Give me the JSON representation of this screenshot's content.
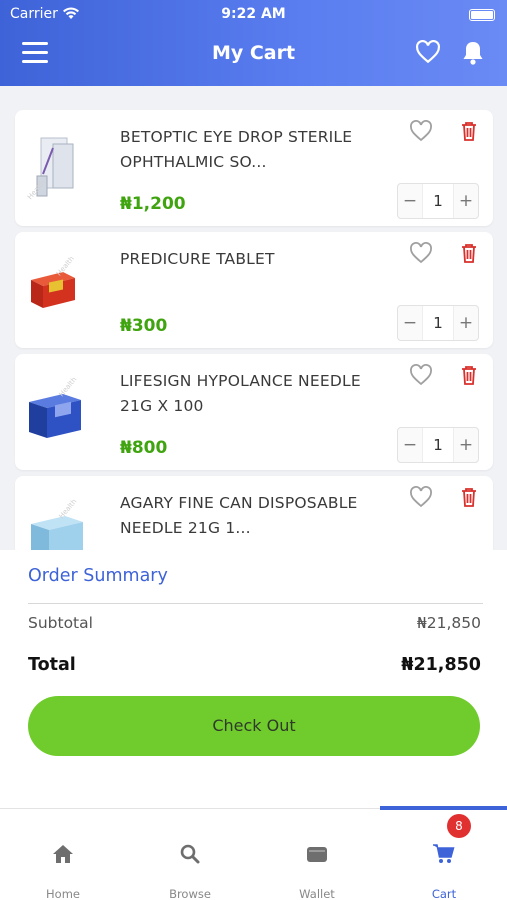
{
  "status_bar": {
    "carrier": "Carrier",
    "time": "9:22 AM"
  },
  "header": {
    "title": "My Cart"
  },
  "icons": {
    "menu": "hamburger-menu-icon",
    "wishlist": "heart-outline-icon",
    "notifications": "bell-icon",
    "delete": "trash-icon"
  },
  "cart": {
    "items": [
      {
        "name": "BETOPTIC EYE DROP STERILE OPHTHALMIC SO...",
        "price": "₦1,200",
        "quantity": "1"
      },
      {
        "name": "PREDICURE TABLET",
        "price": "₦300",
        "quantity": "1"
      },
      {
        "name": "LIFESIGN HYPOLANCE NEEDLE 21G X 100",
        "price": "₦800",
        "quantity": "1"
      },
      {
        "name": "AGARY FINE CAN DISPOSABLE NEEDLE 21G  1...",
        "price": "",
        "quantity": ""
      }
    ],
    "stepper": {
      "minus": "−",
      "plus": "+"
    }
  },
  "summary": {
    "title": "Order Summary",
    "subtotal_label": "Subtotal",
    "subtotal_value": "₦21,850",
    "total_label": "Total",
    "total_value": "₦21,850",
    "checkout_label": "Check Out"
  },
  "bottom_nav": {
    "items": [
      {
        "label": "Home",
        "icon": "home-icon"
      },
      {
        "label": "Browse",
        "icon": "search-icon"
      },
      {
        "label": "Wallet",
        "icon": "wallet-icon"
      },
      {
        "label": "Cart",
        "icon": "cart-icon"
      }
    ],
    "active": "Cart",
    "cart_badge": "8"
  },
  "colors": {
    "header_gradient_start": "#3e63d8",
    "header_gradient_end": "#6a8af4",
    "price_green": "#3fa410",
    "checkout_green": "#70cc2c",
    "delete_red": "#d9302c",
    "accent_blue": "#3e63d8",
    "badge_red": "#e03030"
  }
}
